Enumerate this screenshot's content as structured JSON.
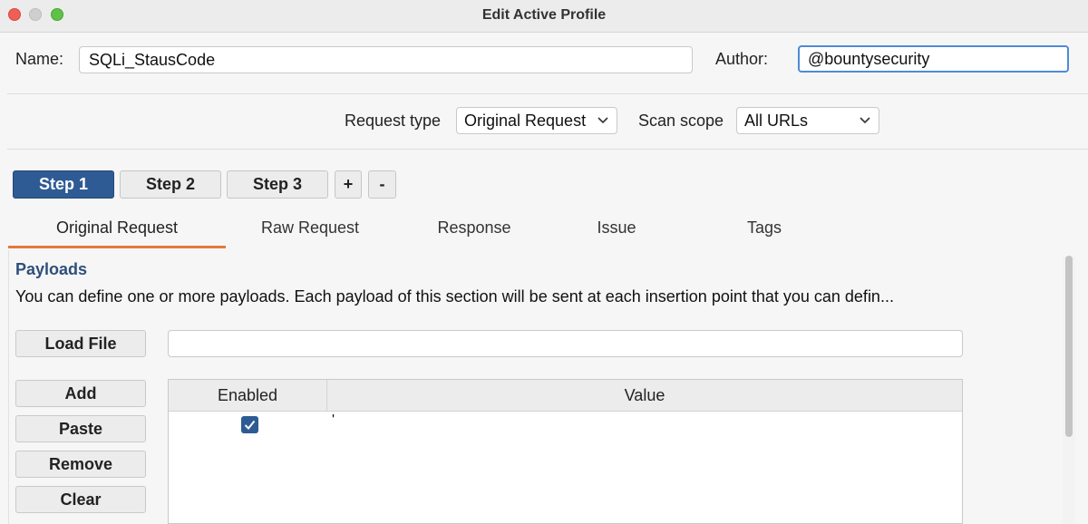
{
  "window": {
    "title": "Edit Active Profile"
  },
  "profile": {
    "name_label": "Name:",
    "name_value": "SQLi_StausCode",
    "author_label": "Author:",
    "author_value": "@bountysecurity"
  },
  "options": {
    "request_type_label": "Request type",
    "request_type_value": "Original Request",
    "scan_scope_label": "Scan scope",
    "scan_scope_value": "All URLs"
  },
  "steps": {
    "items": [
      {
        "label": "Step 1",
        "active": true
      },
      {
        "label": "Step 2",
        "active": false
      },
      {
        "label": "Step 3",
        "active": false
      }
    ],
    "add_label": "+",
    "remove_label": "-"
  },
  "tabs": [
    {
      "label": "Original Request",
      "active": true
    },
    {
      "label": "Raw Request",
      "active": false
    },
    {
      "label": "Response",
      "active": false
    },
    {
      "label": "Issue",
      "active": false
    },
    {
      "label": "Tags",
      "active": false
    }
  ],
  "payloads": {
    "title": "Payloads",
    "description": "You can define one or more payloads. Each payload of this section will be sent at each insertion point that you can defin...",
    "load_file_label": "Load File",
    "file_path": "",
    "add_label": "Add",
    "paste_label": "Paste",
    "remove_label": "Remove",
    "clear_label": "Clear",
    "table": {
      "columns": [
        "Enabled",
        "Value"
      ],
      "rows": [
        {
          "enabled": true,
          "value": "'"
        }
      ]
    }
  },
  "colors": {
    "accent": "#2e5b94",
    "tab_underline": "#e07a3f",
    "section_title": "#2e4f7b",
    "focus_ring": "#4f8ad6"
  }
}
